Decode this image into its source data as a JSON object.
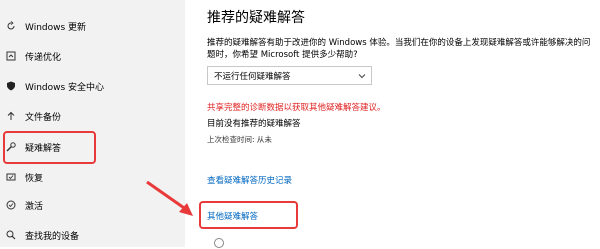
{
  "sidebar": {
    "items": [
      {
        "label": "Windows 更新",
        "icon": "windows-update-icon"
      },
      {
        "label": "传递优化",
        "icon": "delivery-optimization-icon"
      },
      {
        "label": "Windows 安全中心",
        "icon": "shield-icon"
      },
      {
        "label": "文件备份",
        "icon": "backup-icon"
      },
      {
        "label": "疑难解答",
        "icon": "wrench-icon"
      },
      {
        "label": "恢复",
        "icon": "recovery-icon"
      },
      {
        "label": "激活",
        "icon": "activation-icon"
      },
      {
        "label": "查找我的设备",
        "icon": "find-device-icon"
      }
    ]
  },
  "main": {
    "title": "推荐的疑难解答",
    "description": "推荐的疑难解答有助于改进你的 Windows 体验。当我们在你的设备上发现疑难解答或许能够解决的问题时，你希望 Microsoft 提供多少帮助?",
    "select_value": "不运行任何疑难解答",
    "red_notice": "共享完整的诊断数据以获取其他疑难解答建议。",
    "status": "目前没有推荐的疑难解答",
    "last_check": "上次检查时间: 从未",
    "history_link": "查看疑难解答历史记录",
    "other_link": "其他疑难解答"
  },
  "colors": {
    "accent": "#0067c0",
    "annotation": "#e83a3a",
    "warning": "#e02020",
    "sidebar_bg": "#f2f2f2"
  }
}
